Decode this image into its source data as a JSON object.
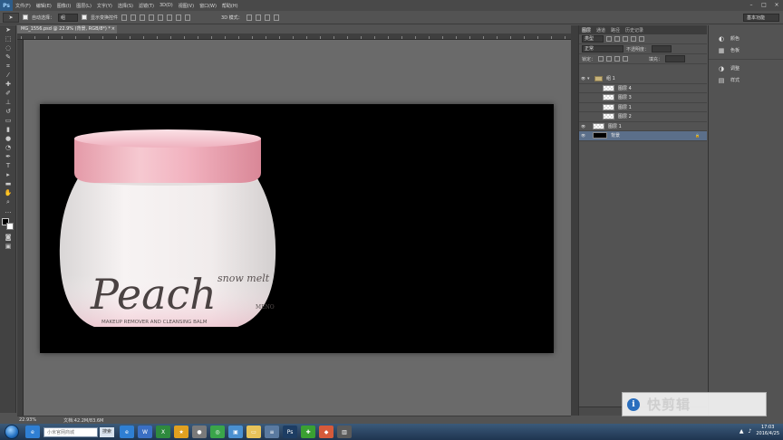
{
  "menu": {
    "logo": "Ps",
    "items": [
      "文件(F)",
      "编辑(E)",
      "图像(I)",
      "图层(L)",
      "文字(Y)",
      "选择(S)",
      "滤镜(T)",
      "3D(D)",
      "视图(V)",
      "窗口(W)",
      "帮助(H)"
    ],
    "win_controls": [
      "–",
      "□",
      "×"
    ]
  },
  "options": {
    "auto_select_label": "自动选择：",
    "auto_select_value": "组",
    "show_transform_label": "显示变换控件",
    "mode_label": "3D 模式：",
    "workspace": "基本功能"
  },
  "document": {
    "tab_title": "MG_1556.psd @ 22.9% (背景, RGB/8*) *",
    "close": "×",
    "zoom": "22.93%",
    "doc_size": "文档:42.2M/83.6M",
    "canvas_bg": "#000000"
  },
  "product": {
    "brand": "Peach",
    "subline": "snow melt",
    "tagline": "MAKEUP REMOVER AND CLEANSING BALM",
    "mark": "MENO",
    "lid_color": "#f2b9c4",
    "jar_color": "#f4eeee"
  },
  "layers_panel": {
    "tabs": [
      "图层",
      "通道",
      "路径",
      "历史记录"
    ],
    "kind_filter": "类型",
    "blend_mode": "正常",
    "opacity_label": "不透明度：",
    "lock_label": "锁定：",
    "fill_label": "填充：",
    "layers": [
      {
        "name": "组 1",
        "kind": "group",
        "visible": true,
        "selected": false,
        "indent": 0
      },
      {
        "name": "图层 4",
        "kind": "layer",
        "visible": false,
        "selected": false,
        "indent": 1
      },
      {
        "name": "图层 3",
        "kind": "layer",
        "visible": false,
        "selected": false,
        "indent": 1
      },
      {
        "name": "图层 1",
        "kind": "layer",
        "visible": false,
        "selected": false,
        "indent": 1
      },
      {
        "name": "图层 2",
        "kind": "layer",
        "visible": false,
        "selected": false,
        "indent": 1
      },
      {
        "name": "图层 1",
        "kind": "layer",
        "visible": true,
        "selected": false,
        "indent": 0
      },
      {
        "name": "背景",
        "kind": "background",
        "visible": true,
        "selected": true,
        "indent": 0
      }
    ]
  },
  "adjust_panel": {
    "items": [
      {
        "icon": "◐",
        "label": "颜色"
      },
      {
        "icon": "▦",
        "label": "色板"
      },
      {
        "icon": "◑",
        "label": "调整"
      },
      {
        "icon": "▤",
        "label": "样式"
      }
    ]
  },
  "watermark": {
    "text": "快剪辑"
  },
  "taskbar": {
    "search_placeholder": "小米官网商城",
    "search_button": "搜索",
    "time": "17:03",
    "date": "2016/4/25",
    "apps": [
      {
        "label": "e",
        "color": "#2f7fd3"
      },
      {
        "label": "W",
        "color": "#3a6fc4"
      },
      {
        "label": "X",
        "color": "#2e8a3e"
      },
      {
        "label": "★",
        "color": "#e0a020"
      },
      {
        "label": "●",
        "color": "#7a7a7a"
      },
      {
        "label": "◎",
        "color": "#3aa54a"
      },
      {
        "label": "▣",
        "color": "#4a90d0"
      },
      {
        "label": "▭",
        "color": "#e7c35a"
      },
      {
        "label": "≡",
        "color": "#5a7aa0"
      },
      {
        "label": "Ps",
        "color": "#1d3d63"
      },
      {
        "label": "✚",
        "color": "#3aa032"
      },
      {
        "label": "◆",
        "color": "#d65a3a"
      },
      {
        "label": "▥",
        "color": "#5a5a5a"
      }
    ]
  }
}
